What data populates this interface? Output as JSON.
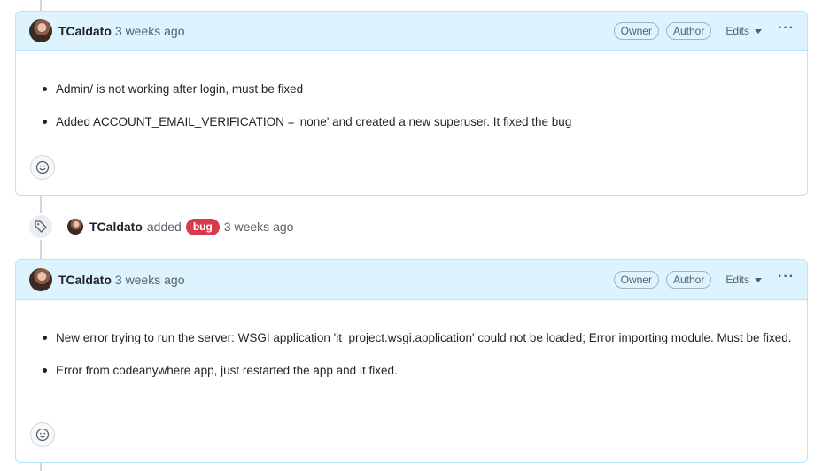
{
  "comments": [
    {
      "author": "TCaldato",
      "time": "3 weeks ago",
      "badges": [
        "Owner",
        "Author"
      ],
      "edits_label": "Edits",
      "items": [
        "Admin/ is not working after login, must be fixed",
        "Added ACCOUNT_EMAIL_VERIFICATION = 'none' and created a new superuser. It fixed the bug"
      ]
    },
    {
      "author": "TCaldato",
      "time": "3 weeks ago",
      "badges": [
        "Owner",
        "Author"
      ],
      "edits_label": "Edits",
      "items": [
        "New error trying to run the server: WSGI application 'it_project.wsgi.application' could not be loaded; Error importing module. Must be fixed.",
        "Error from codeanywhere app, just restarted the app and it fixed."
      ]
    }
  ],
  "event": {
    "icon": "tag-icon",
    "author": "TCaldato",
    "action": "added",
    "label": "bug",
    "label_color": "#d73a4a",
    "time": "3 weeks ago"
  },
  "colors": {
    "header_bg": "#ddf4ff",
    "border": "#b6e3ff"
  }
}
